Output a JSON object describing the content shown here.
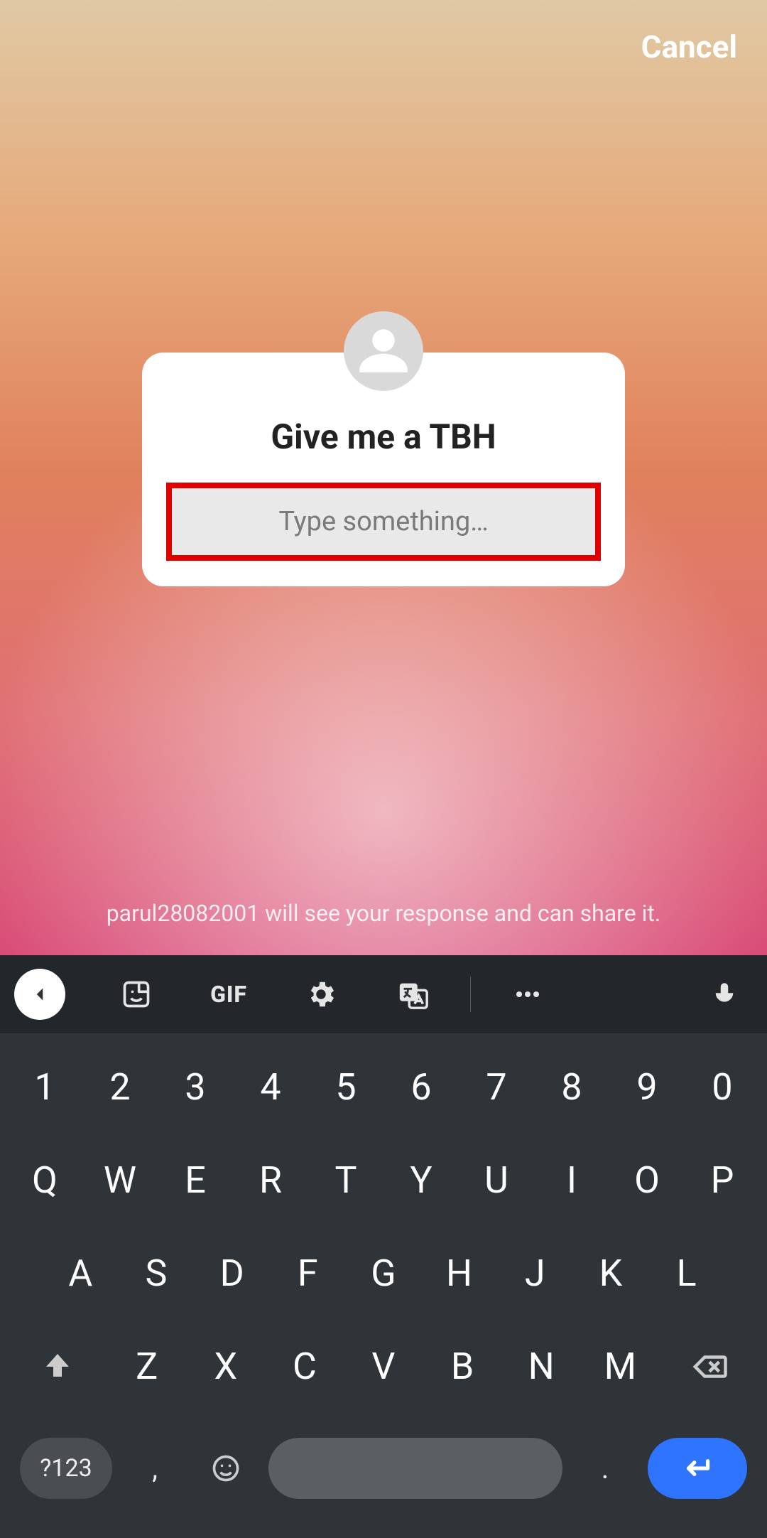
{
  "header": {
    "cancel": "Cancel"
  },
  "card": {
    "title": "Give me a TBH",
    "placeholder": "Type something…"
  },
  "footer": {
    "disclosure": "parul28082001 will see your response and can share it."
  },
  "keyboard": {
    "toolbar": {
      "gif": "GIF"
    },
    "rows": {
      "numbers": [
        "1",
        "2",
        "3",
        "4",
        "5",
        "6",
        "7",
        "8",
        "9",
        "0"
      ],
      "r1": [
        "Q",
        "W",
        "E",
        "R",
        "T",
        "Y",
        "U",
        "I",
        "O",
        "P"
      ],
      "r2": [
        "A",
        "S",
        "D",
        "F",
        "G",
        "H",
        "J",
        "K",
        "L"
      ],
      "r3": [
        "Z",
        "X",
        "C",
        "V",
        "B",
        "N",
        "M"
      ]
    },
    "bottom": {
      "symbols": "?123",
      "comma": ",",
      "period": "."
    }
  }
}
